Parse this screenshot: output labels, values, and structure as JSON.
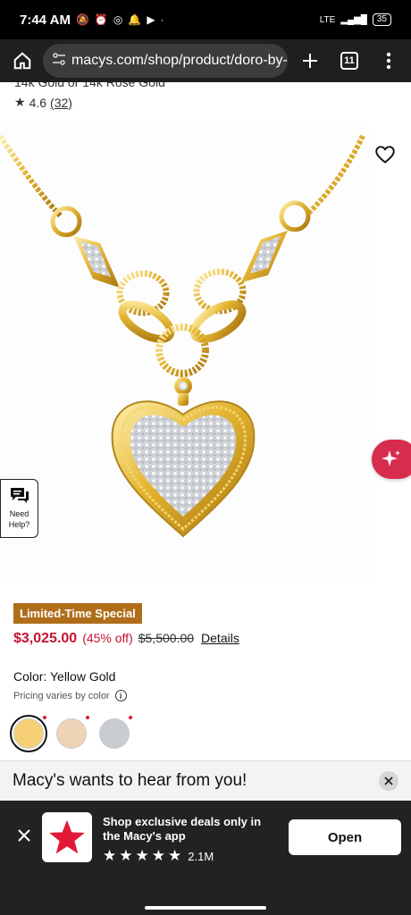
{
  "status_bar": {
    "time": "7:44 AM",
    "battery": "35",
    "network": "LTE"
  },
  "browser": {
    "url": "macys.com/shop/product/doro-by-",
    "tab_count": "11",
    "icons": [
      "home-icon",
      "tune-icon",
      "plus-icon",
      "tabs-icon",
      "more-icon"
    ]
  },
  "product": {
    "title_fragment": "14k Gold or 14k Rose Gold",
    "rating": "4.6",
    "review_count": "(32)",
    "badge": "Limited-Time Special",
    "sale_price": "$3,025.00",
    "percent_off": "(45% off)",
    "original_price": "$5,500.00",
    "details_link": "Details",
    "color_label": "Color: Yellow Gold",
    "pricing_note": "Pricing varies by color",
    "swatches": [
      {
        "name": "Yellow Gold",
        "color": "#f6cf76",
        "selected": true
      },
      {
        "name": "Rose Gold",
        "color": "#efd3b6",
        "selected": false
      },
      {
        "name": "White Gold",
        "color": "#c9ccd1",
        "selected": false
      }
    ]
  },
  "need_help": {
    "line1": "Need",
    "line2": "Help?"
  },
  "feedback": {
    "text": "Macy's wants to hear from you!"
  },
  "app_banner": {
    "text": "Shop exclusive deals only in the Macy's app",
    "reviews": "2.1M",
    "stars": 5,
    "open_label": "Open"
  },
  "colors": {
    "brand_red": "#e31837",
    "sale_red": "#c7122f",
    "badge_bg": "#b06e1b",
    "ai_button": "#d62c4e"
  }
}
